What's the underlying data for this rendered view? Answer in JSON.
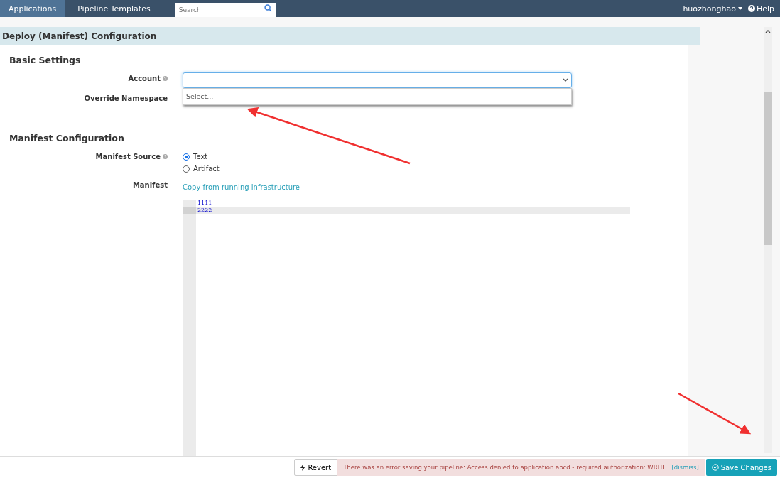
{
  "nav": {
    "tabs": [
      {
        "label": "Applications",
        "selected": true
      },
      {
        "label": "Pipeline Templates",
        "selected": false
      }
    ],
    "search": {
      "placeholder": "Search"
    },
    "user": "huozhonghao",
    "help": "Help"
  },
  "panel": {
    "title": "Deploy (Manifest) Configuration",
    "basic": {
      "heading": "Basic Settings",
      "account_label": "Account",
      "account_dropdown": {
        "expanded": true,
        "option": "Select..."
      },
      "namespace_label": "Override Namespace"
    },
    "manifest": {
      "heading": "Manifest Configuration",
      "source_label": "Manifest Source",
      "sources": [
        {
          "label": "Text",
          "selected": true
        },
        {
          "label": "Artifact",
          "selected": false
        }
      ],
      "manifest_label": "Manifest",
      "copy_link": "Copy from running infrastructure",
      "lines": [
        {
          "text": "1111",
          "active": false
        },
        {
          "text": "2222",
          "active": true
        }
      ]
    }
  },
  "footer": {
    "revert": "Revert",
    "error": "There was an error saving your pipeline: Access denied to application abcd - required authorization: WRITE.",
    "dismiss": "[dismiss]",
    "save": "Save Changes"
  }
}
